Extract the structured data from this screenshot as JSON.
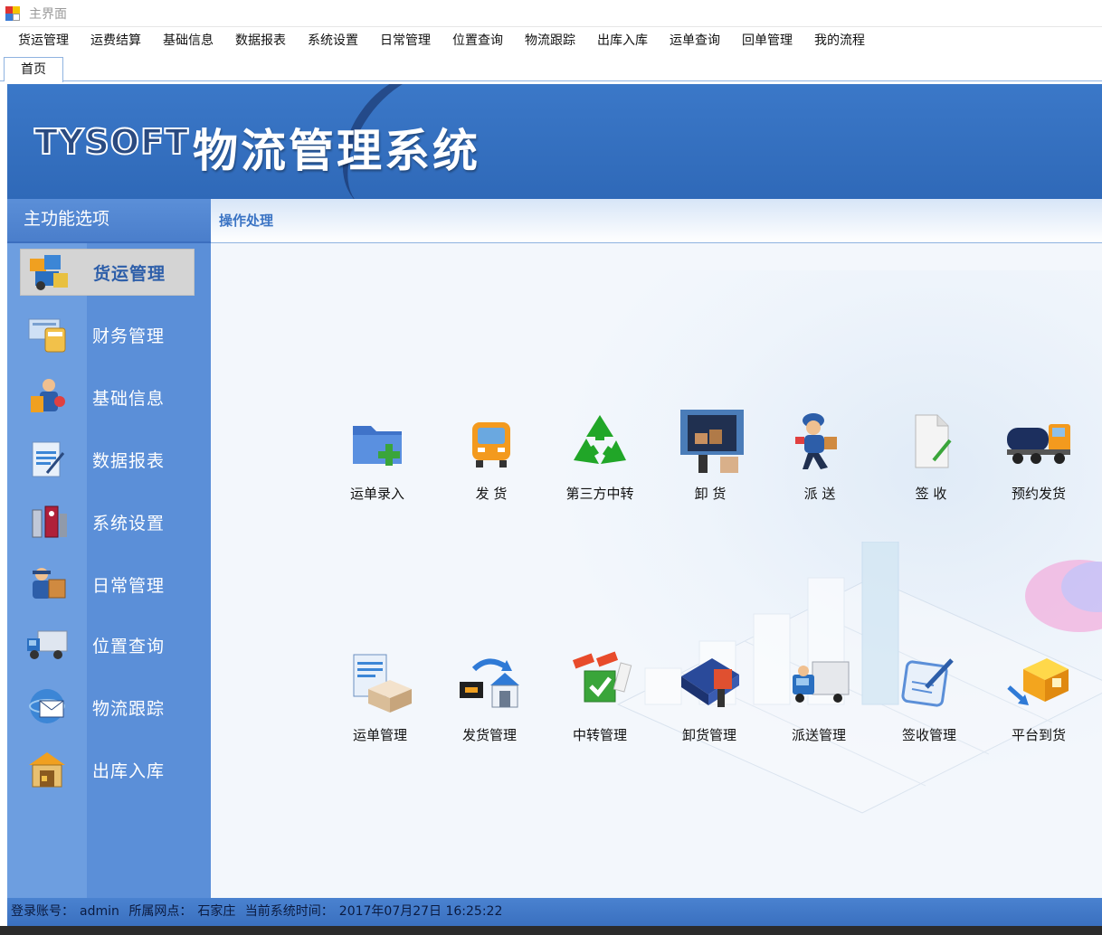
{
  "window": {
    "title": "主界面"
  },
  "menu": [
    "货运管理",
    "运费结算",
    "基础信息",
    "数据报表",
    "系统设置",
    "日常管理",
    "位置查询",
    "物流跟踪",
    "出库入库",
    "运单查询",
    "回单管理",
    "我的流程"
  ],
  "tabs": [
    {
      "label": "首页"
    }
  ],
  "banner": {
    "brand": "TYSOFT",
    "title": "物流管理系统"
  },
  "sidebar": {
    "header": "主功能选项",
    "items": [
      {
        "label": "货运管理",
        "icon": "freight-icon",
        "active": true
      },
      {
        "label": "财务管理",
        "icon": "finance-icon"
      },
      {
        "label": "基础信息",
        "icon": "basic-info-icon"
      },
      {
        "label": "数据报表",
        "icon": "report-icon"
      },
      {
        "label": "系统设置",
        "icon": "settings-icon"
      },
      {
        "label": "日常管理",
        "icon": "daily-icon"
      },
      {
        "label": "位置查询",
        "icon": "location-truck-icon"
      },
      {
        "label": "物流跟踪",
        "icon": "tracking-icon"
      },
      {
        "label": "出库入库",
        "icon": "warehouse-icon"
      }
    ]
  },
  "main": {
    "header": "操作处理",
    "row1": [
      {
        "label": "运单录入",
        "icon": "folder-add-icon"
      },
      {
        "label": "发  货",
        "icon": "truck-front-icon"
      },
      {
        "label": "第三方中转",
        "icon": "recycle-icon"
      },
      {
        "label": "卸  货",
        "icon": "unload-icon"
      },
      {
        "label": "派  送",
        "icon": "courier-icon"
      },
      {
        "label": "签  收",
        "icon": "sign-doc-icon"
      },
      {
        "label": "预约发货",
        "icon": "tanker-truck-icon"
      }
    ],
    "row2": [
      {
        "label": "运单管理",
        "icon": "waybill-box-icon"
      },
      {
        "label": "发货管理",
        "icon": "dispatch-house-icon"
      },
      {
        "label": "中转管理",
        "icon": "transfer-check-icon"
      },
      {
        "label": "卸货管理",
        "icon": "unload-book-icon"
      },
      {
        "label": "派送管理",
        "icon": "delivery-truck-icon"
      },
      {
        "label": "签收管理",
        "icon": "sign-pen-icon"
      },
      {
        "label": "平台到货",
        "icon": "platform-arrival-icon"
      }
    ]
  },
  "status": {
    "account_label": "登录账号：",
    "account": "admin",
    "branch_label": "所属网点：",
    "branch": "石家庄",
    "time_label": "当前系统时间：",
    "time": "2017年07月27日 16:25:22"
  },
  "colors": {
    "banner": "#3b78c8",
    "sidebar": "#5b8fd8",
    "accent": "#3b74c4",
    "statusbar": "#3a70bf"
  }
}
